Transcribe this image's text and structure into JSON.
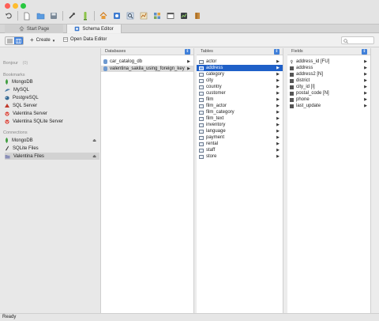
{
  "window": {
    "traffic_lights": [
      "#fe5f57",
      "#febc2e",
      "#28c840"
    ]
  },
  "toolbar": {
    "icons": [
      "undo-icon",
      "new-document-icon",
      "open-folder-icon",
      "save-icon",
      "tools-icon",
      "connection-icon",
      "home-icon",
      "schema-icon",
      "query-icon",
      "report-icon",
      "forms-icon",
      "window-icon",
      "chart-icon",
      "book-icon"
    ]
  },
  "tabs": [
    {
      "label": "Start Page",
      "active": false
    },
    {
      "label": "Schema Editor",
      "active": true
    }
  ],
  "commands": {
    "create_label": "Create",
    "open_data_editor_label": "Open Data Editor"
  },
  "sidebar": {
    "bonjour_header": "Bonjour",
    "bonjour_badge": "(0)",
    "bookmarks_header": "Bookmarks",
    "bookmarks": [
      {
        "label": "MongoDB",
        "icon": "mongodb-icon",
        "color": "#3f9e3f"
      },
      {
        "label": "MySQL",
        "icon": "mysql-icon",
        "color": "#4a7ba6"
      },
      {
        "label": "PostgreSQL",
        "icon": "postgresql-icon",
        "color": "#336791"
      },
      {
        "label": "SQL Server",
        "icon": "sqlserver-icon",
        "color": "#c0392b"
      },
      {
        "label": "Valentina Server",
        "icon": "valentina-icon",
        "color": "#d9453a"
      },
      {
        "label": "Valentina SQLite Server",
        "icon": "valentina-sqlite-icon",
        "color": "#d9453a"
      }
    ],
    "connections_header": "Connections",
    "connections": [
      {
        "label": "MongoDB",
        "icon": "mongodb-icon",
        "color": "#3f9e3f",
        "eject": true,
        "selected": false
      },
      {
        "label": "SQLite Files",
        "icon": "sqlite-icon",
        "color": "#333333",
        "eject": false,
        "selected": false
      },
      {
        "label": "Valentina Files",
        "icon": "valentina-files-icon",
        "color": "#8a8fb8",
        "eject": true,
        "selected": true
      }
    ]
  },
  "databases": {
    "header": "Databases",
    "items": [
      {
        "label": "car_catalog_db",
        "state": "normal"
      },
      {
        "label": "valentina_sakila_using_foreign_key",
        "state": "highlight"
      }
    ]
  },
  "tables": {
    "header": "Tables",
    "items": [
      {
        "label": "actor",
        "state": "normal"
      },
      {
        "label": "address",
        "state": "selected"
      },
      {
        "label": "category",
        "state": "normal"
      },
      {
        "label": "city",
        "state": "normal"
      },
      {
        "label": "country",
        "state": "normal"
      },
      {
        "label": "customer",
        "state": "normal"
      },
      {
        "label": "film",
        "state": "normal"
      },
      {
        "label": "film_actor",
        "state": "normal"
      },
      {
        "label": "film_category",
        "state": "normal"
      },
      {
        "label": "film_text",
        "state": "normal"
      },
      {
        "label": "inventory",
        "state": "normal"
      },
      {
        "label": "language",
        "state": "normal"
      },
      {
        "label": "payment",
        "state": "normal"
      },
      {
        "label": "rental",
        "state": "normal"
      },
      {
        "label": "staff",
        "state": "normal"
      },
      {
        "label": "store",
        "state": "normal"
      }
    ]
  },
  "fields": {
    "header": "Fields",
    "items": [
      {
        "label": "address_id [FU]",
        "icon": "key-icon"
      },
      {
        "label": "address",
        "icon": "field-icon"
      },
      {
        "label": "address2 [N]",
        "icon": "field-icon"
      },
      {
        "label": "district",
        "icon": "field-icon"
      },
      {
        "label": "city_id [I]",
        "icon": "field-icon"
      },
      {
        "label": "postal_code [N]",
        "icon": "field-icon"
      },
      {
        "label": "phone",
        "icon": "field-icon"
      },
      {
        "label": "last_update",
        "icon": "field-icon"
      }
    ]
  },
  "status": {
    "text": "Ready"
  },
  "colors": {
    "selection": "#1f60c8",
    "accent": "#3f7fd9"
  }
}
